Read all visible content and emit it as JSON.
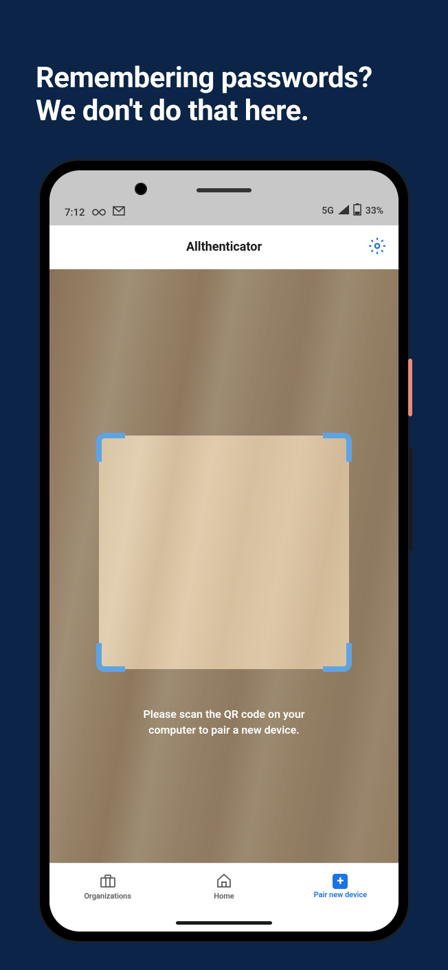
{
  "headline": {
    "line1": "Remembering passwords?",
    "line2": "We don't do that here."
  },
  "status": {
    "time": "7:12",
    "network": "5G",
    "battery": "33%"
  },
  "topbar": {
    "title": "Allthenticator"
  },
  "scan": {
    "instruction": "Please scan the QR code on your computer to pair a new device."
  },
  "nav": {
    "organizations": "Organizations",
    "home": "Home",
    "pair": "Pair new device"
  }
}
